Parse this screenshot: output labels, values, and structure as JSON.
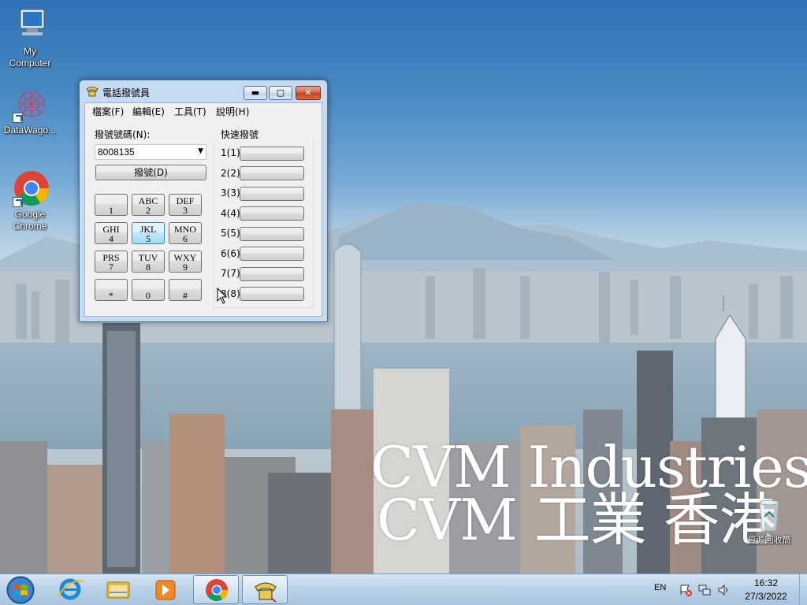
{
  "desktop": {
    "icons": [
      {
        "label_line1": "My",
        "label_line2": "Computer",
        "icon": "my-computer-icon"
      },
      {
        "label_line1": "DataWago...",
        "label_line2": "",
        "icon": "datawagon-icon"
      },
      {
        "label_line1": "Google",
        "label_line2": "Chrome",
        "icon": "chrome-icon"
      }
    ],
    "recycle_bin_label": "資源回收筒",
    "wallpaper_text_line1": "CVM Industries",
    "wallpaper_text_line2": "CVM 工業 香港"
  },
  "window": {
    "title": "電話撥號員",
    "menu": [
      "檔案(F)",
      "編輯(E)",
      "工具(T)",
      "說明(H)"
    ],
    "number_label": "撥號號碼(N):",
    "number_value": "8008135",
    "dial_button": "撥號(D)",
    "keypad": [
      {
        "top": "",
        "bottom": "1"
      },
      {
        "top": "ABC",
        "bottom": "2"
      },
      {
        "top": "DEF",
        "bottom": "3"
      },
      {
        "top": "GHI",
        "bottom": "4"
      },
      {
        "top": "JKL",
        "bottom": "5"
      },
      {
        "top": "MNO",
        "bottom": "6"
      },
      {
        "top": "PRS",
        "bottom": "7"
      },
      {
        "top": "TUV",
        "bottom": "8"
      },
      {
        "top": "WXY",
        "bottom": "9"
      },
      {
        "top": "",
        "bottom": "*"
      },
      {
        "top": "",
        "bottom": "0"
      },
      {
        "top": "",
        "bottom": "#"
      }
    ],
    "focused_key": "5",
    "speed_dial_label": "快速撥號",
    "speed_dial": [
      "1(1)",
      "2(2)",
      "3(3)",
      "4(4)",
      "5(5)",
      "6(6)",
      "7(7)",
      "8(8)"
    ]
  },
  "taskbar": {
    "language": "EN",
    "time": "16:32",
    "date": "27/3/2022",
    "pinned": [
      "start-orb",
      "internet-explorer-icon",
      "file-explorer-icon",
      "media-player-icon",
      "chrome-icon",
      "phone-dialer-icon"
    ]
  },
  "colors": {
    "accent": "#3c7fb1",
    "close_button": "#c2431f",
    "window_frame": "#c6dbf0"
  }
}
